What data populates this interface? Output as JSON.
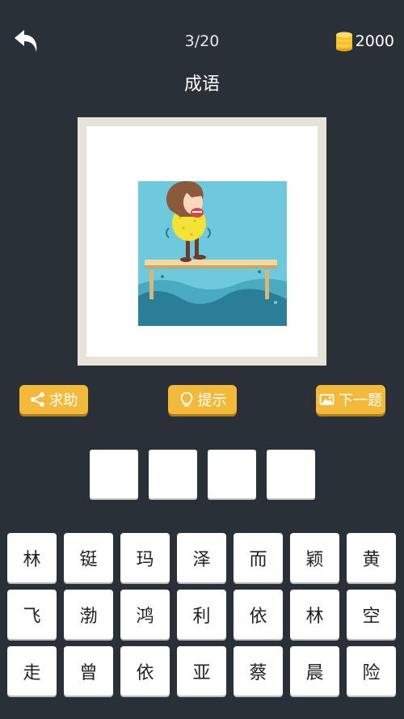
{
  "header": {
    "back_icon": "back-arrow-icon",
    "progress": "3/20",
    "coin_icon": "coin-stack-icon",
    "coins": "2000",
    "category": "成语"
  },
  "buttons": {
    "help": {
      "label": "求助",
      "icon": "share-icon"
    },
    "hint": {
      "label": "提示",
      "icon": "lightbulb-icon"
    },
    "next": {
      "label": "下一题",
      "icon": "picture-icon"
    }
  },
  "answer_slots": [
    "",
    "",
    "",
    ""
  ],
  "letters": [
    "林",
    "铤",
    "玛",
    "泽",
    "而",
    "颖",
    "黄",
    "飞",
    "渤",
    "鸿",
    "利",
    "依",
    "林",
    "空",
    "走",
    "曾",
    "依",
    "亚",
    "蔡",
    "晨",
    "险"
  ],
  "colors": {
    "background": "#2a3038",
    "button": "#f3b93a",
    "water": "#6ec9dc",
    "wave": "#2a7e98"
  }
}
